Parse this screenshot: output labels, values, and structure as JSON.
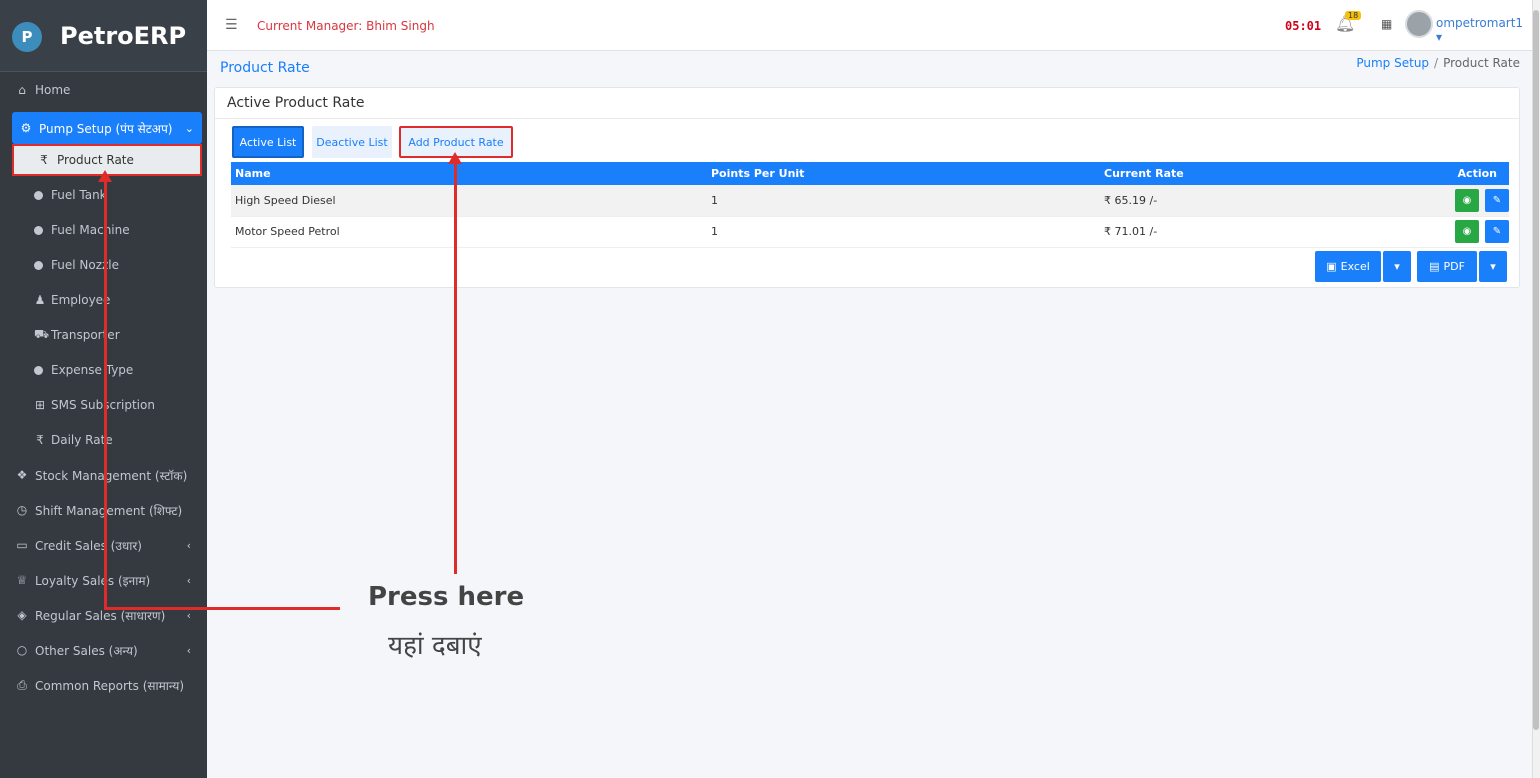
{
  "brand": {
    "name": "PetroERP",
    "logo_letter": "P"
  },
  "topbar": {
    "menu_icon": "☰",
    "manager_text": "Current Manager: Bhim Singh",
    "timer": "05:01",
    "notification_count": "18",
    "username": "ompetromart1"
  },
  "sidebar": {
    "items": [
      {
        "label": "Home",
        "icon": "home-icon"
      },
      {
        "label": "Pump Setup (पंप सेटअप)",
        "icon": "cogs-icon"
      },
      {
        "label": "Product Rate",
        "icon": "rupee-icon"
      },
      {
        "label": "Fuel Tank"
      },
      {
        "label": "Fuel Machine"
      },
      {
        "label": "Fuel Nozzle"
      },
      {
        "label": "Employee",
        "icon": "user-icon"
      },
      {
        "label": "Transporter",
        "icon": "truck-icon"
      },
      {
        "label": "Expense Type"
      },
      {
        "label": "SMS Subscription",
        "icon": "plus-square-icon"
      },
      {
        "label": "Daily Rate",
        "icon": "rupee-icon"
      },
      {
        "label": "Stock Management (स्टॉक)",
        "icon": "cubes-icon"
      },
      {
        "label": "Shift Management (शिफ्ट)",
        "icon": "clock-icon"
      },
      {
        "label": "Credit Sales (उधार)",
        "icon": "credit-card-icon"
      },
      {
        "label": "Loyalty Sales (इनाम)",
        "icon": "trophy-icon"
      },
      {
        "label": "Regular Sales (साधारण)",
        "icon": "box-icon"
      },
      {
        "label": "Other Sales (अन्य)",
        "icon": "circle-icon"
      },
      {
        "label": "Common Reports (सामान्य)",
        "icon": "print-icon"
      }
    ]
  },
  "page": {
    "title": "Product Rate",
    "breadcrumb": {
      "parent": "Pump Setup",
      "separator": "/",
      "current": "Product Rate"
    }
  },
  "card": {
    "title": "Active Product Rate",
    "tabs": {
      "active": "Active List",
      "deactive": "Deactive List",
      "add": "Add Product Rate"
    },
    "table": {
      "headers": {
        "name": "Name",
        "points": "Points Per Unit",
        "rate": "Current Rate",
        "action": "Action"
      },
      "rows": [
        {
          "name": "High Speed Diesel",
          "points": "1",
          "rate": "₹ 65.19 /-"
        },
        {
          "name": "Motor Speed Petrol",
          "points": "1",
          "rate": "₹ 71.01 /-"
        }
      ]
    },
    "export": {
      "excel": "Excel",
      "pdf": "PDF"
    }
  },
  "annotation": {
    "english": "Press here",
    "hindi": "यहां दबाएं"
  }
}
